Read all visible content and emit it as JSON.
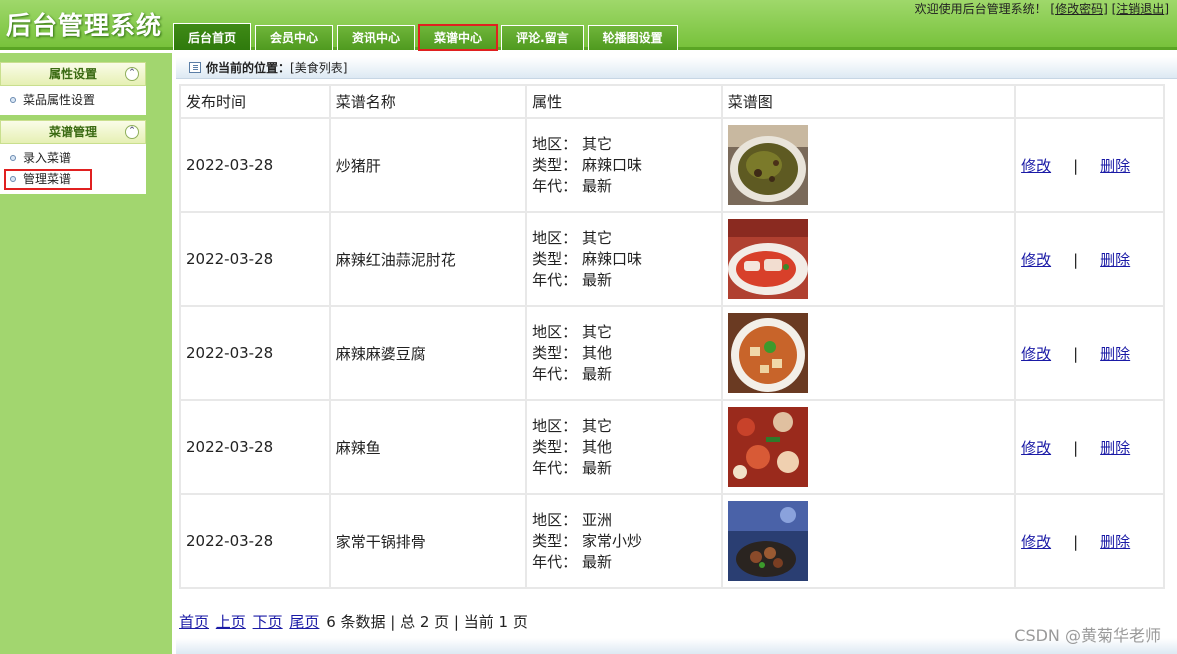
{
  "header": {
    "system_title": "后台管理系统",
    "welcome_text": "欢迎使用后台管理系统！",
    "change_password_link": "修改密码",
    "logout_link": "注销退出"
  },
  "nav": {
    "tabs": [
      {
        "label": "后台首页"
      },
      {
        "label": "会员中心"
      },
      {
        "label": "资讯中心"
      },
      {
        "label": "菜谱中心"
      },
      {
        "label": "评论.留言"
      },
      {
        "label": "轮播图设置"
      }
    ]
  },
  "sidebar": {
    "groups": [
      {
        "title": "属性设置",
        "items": [
          "菜品属性设置"
        ]
      },
      {
        "title": "菜谱管理",
        "items": [
          "录入菜谱",
          "管理菜谱"
        ]
      }
    ],
    "collapse_glyph": "⌃"
  },
  "breadcrumb": {
    "label": "你当前的位置：",
    "location": "[美食列表]"
  },
  "table": {
    "headers": [
      "发布时间",
      "菜谱名称",
      "属性",
      "菜谱图",
      ""
    ],
    "attr_labels": {
      "region": "地区：",
      "type": "类型：",
      "era": "年代："
    },
    "rows": [
      {
        "date": "2022-03-28",
        "name": "炒猪肝",
        "region": "其它",
        "type": "麻辣口味",
        "era": "最新",
        "image_icon": "stir-fried-liver-photo"
      },
      {
        "date": "2022-03-28",
        "name": "麻辣红油蒜泥肘花",
        "region": "其它",
        "type": "麻辣口味",
        "era": "最新",
        "image_icon": "pork-knuckle-chili-oil-photo"
      },
      {
        "date": "2022-03-28",
        "name": "麻辣麻婆豆腐",
        "region": "其它",
        "type": "其他",
        "era": "最新",
        "image_icon": "mapo-tofu-photo"
      },
      {
        "date": "2022-03-28",
        "name": "麻辣鱼",
        "region": "其它",
        "type": "其他",
        "era": "最新",
        "image_icon": "spicy-fish-photo"
      },
      {
        "date": "2022-03-28",
        "name": "家常干锅排骨",
        "region": "亚洲",
        "type": "家常小炒",
        "era": "最新",
        "image_icon": "dry-pot-ribs-photo"
      }
    ],
    "edit_label": "修改",
    "separator": "|",
    "delete_label": "删除"
  },
  "pager": {
    "first": "首页",
    "prev": "上页",
    "next": "下页",
    "last": "尾页",
    "summary": "6 条数据 | 总 2 页 | 当前 1 页"
  },
  "watermark": "CSDN @黄菊华老师",
  "colors": {
    "header_green": "#78c23c",
    "sidebar_green": "#a2d66f",
    "active_tab": "#2f7a0d",
    "highlight_red": "#e02020",
    "link_blue": "#1a1aa6"
  }
}
